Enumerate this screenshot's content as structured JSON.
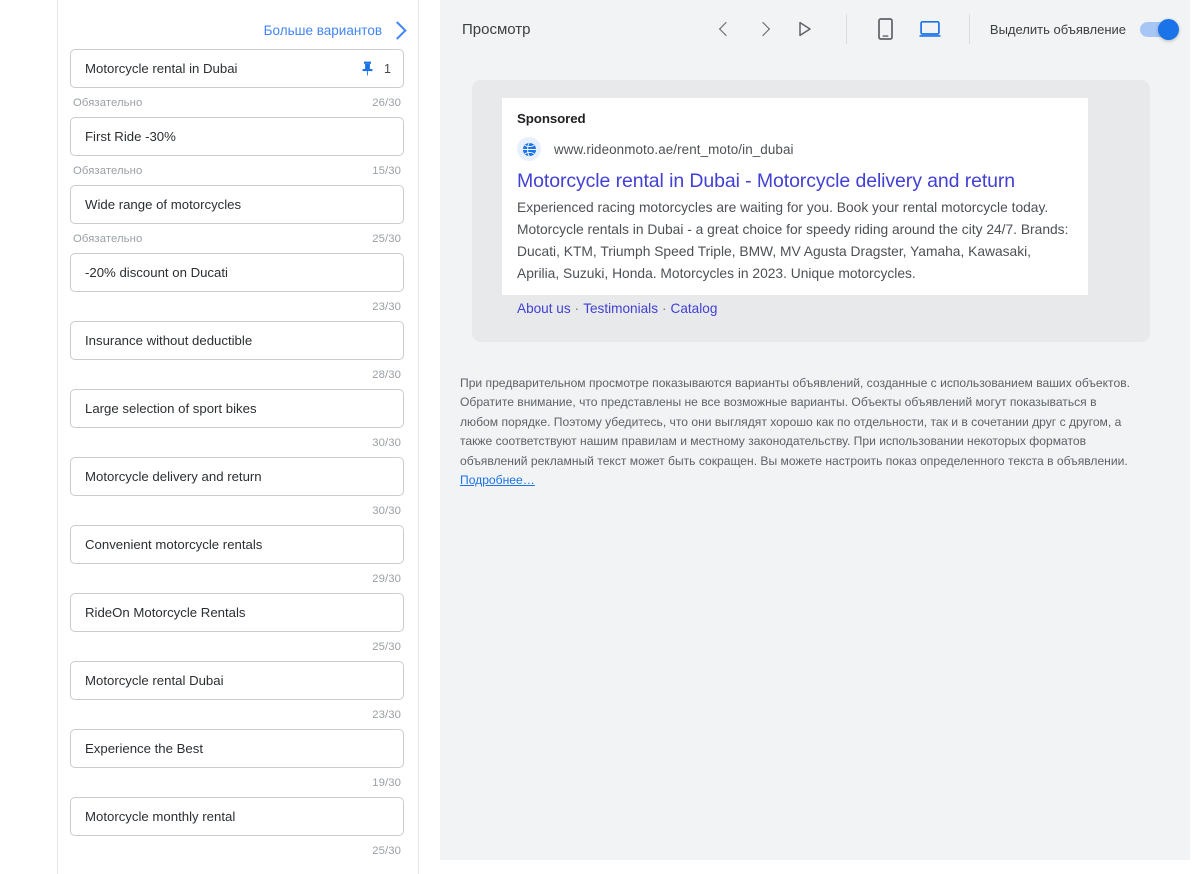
{
  "left_panel": {
    "more_options_label": "Больше вариантов",
    "more_options_icon": "chevron-right-icon",
    "required_label": "Обязательно",
    "assets": [
      {
        "text": "Motorcycle rental in Dubai",
        "required": "Обязательно",
        "count": "26/30",
        "pinned": true,
        "pin_count": "1"
      },
      {
        "text": "First Ride -30%",
        "required": "Обязательно",
        "count": "15/30",
        "pinned": false,
        "pin_count": ""
      },
      {
        "text": "Wide range of motorcycles",
        "required": "Обязательно",
        "count": "25/30",
        "pinned": false,
        "pin_count": ""
      },
      {
        "text": "-20% discount on Ducati",
        "required": "",
        "count": "23/30",
        "pinned": false,
        "pin_count": ""
      },
      {
        "text": "Insurance without deductible",
        "required": "",
        "count": "28/30",
        "pinned": false,
        "pin_count": ""
      },
      {
        "text": "Large selection of sport bikes",
        "required": "",
        "count": "30/30",
        "pinned": false,
        "pin_count": ""
      },
      {
        "text": "Motorcycle delivery and return",
        "required": "",
        "count": "30/30",
        "pinned": false,
        "pin_count": ""
      },
      {
        "text": "Convenient motorcycle rentals",
        "required": "",
        "count": "29/30",
        "pinned": false,
        "pin_count": ""
      },
      {
        "text": "RideOn Motorcycle Rentals",
        "required": "",
        "count": "25/30",
        "pinned": false,
        "pin_count": ""
      },
      {
        "text": "Motorcycle rental Dubai",
        "required": "",
        "count": "23/30",
        "pinned": false,
        "pin_count": ""
      },
      {
        "text": "Experience the Best",
        "required": "",
        "count": "19/30",
        "pinned": false,
        "pin_count": ""
      },
      {
        "text": "Motorcycle monthly rental",
        "required": "",
        "count": "25/30",
        "pinned": false,
        "pin_count": ""
      }
    ]
  },
  "preview": {
    "title": "Просмотр",
    "nav": {
      "prev_icon": "chevron-left-icon",
      "next_icon": "chevron-right-icon",
      "play_icon": "play-triangle-icon"
    },
    "devices": {
      "mobile_icon": "mobile-phone-icon",
      "desktop_icon": "desktop-monitor-icon",
      "selected": "desktop"
    },
    "highlight_toggle": {
      "label": "Выделить объявление",
      "enabled": true,
      "accent_color": "#1a73e8"
    }
  },
  "ad": {
    "sponsored_label": "Sponsored",
    "favicon_icon": "globe-icon",
    "display_url": "www.rideonmoto.ae/rent_moto/in_dubai",
    "headline": "Motorcycle rental in Dubai - Motorcycle delivery and return",
    "description": "Experienced racing motorcycles are waiting for you. Book your rental motorcycle today. Motorcycle rentals in Dubai - a great choice for speedy riding around the city 24/7. Brands: Ducati, KTM, Triumph Speed Triple, BMW, MV Agusta Dragster, Yamaha, Kawasaki, Aprilia, Suzuki, Honda. Motorcycles in 2023. Unique motorcycles.",
    "sitelinks": [
      "About us",
      "Testimonials",
      "Catalog"
    ],
    "headline_color": "#4340d4"
  },
  "disclaimer": {
    "text": "При предварительном просмотре показываются варианты объявлений, созданные с использованием ваших объектов. Обратите внимание, что представлены не все возможные варианты. Объекты объявлений могут показываться в любом порядке. Поэтому убедитесь, что они выглядят хорошо как по отдельности, так и в сочетании друг с другом, а также соответствуют нашим правилам и местному законодательству. При использовании некоторых форматов объявлений рекламный текст может быть сокращен. Вы можете настроить показ определенного текста в объявлении.",
    "link_label": "Подробнее…"
  }
}
